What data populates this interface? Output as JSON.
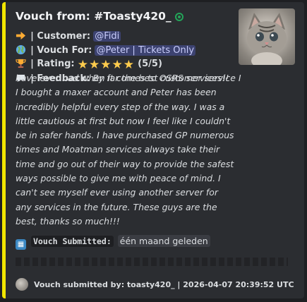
{
  "embed": {
    "accent_color": "#f1e500",
    "title": "Vouch from: #Toasty420_",
    "title_icon": "check-circle-icon",
    "customer_label": "| Customer:",
    "customer_mention": "@Fidi",
    "vouch_for_label": "| Vouch For:",
    "vouch_for_mention": "@Peter | Tickets Only",
    "rating_label": "| Rating:",
    "rating_stars": 5,
    "rating_text": "(5/5)",
    "feedback_label": "| Feedback:",
    "feedback_first": "By far the best customer service I",
    "feedback_rest": "have ever had when it comes to OSRS services!! I bought a maxer account and Peter has been incredibly helpful every step of the way. I was a little cautious at first but now I feel like I couldn't be in safer hands. I have purchased GP numerous times and Moatman services always take their time and go out of their way to provide the safest ways possible to give me with peace of mind. I can't see myself ever using another server for any services in the future. These guys are the best, thanks so much!!!",
    "submitted_label": "Vouch Submitted:",
    "submitted_time": "één maand geleden",
    "footer_text": "Vouch submitted by: toasty420_ | 2026-04-07 20:39:52 UTC",
    "icons": {
      "customer": "arrow-right-icon",
      "vouch_for": "globe-icon",
      "rating": "trophy-icon",
      "feedback": "speech-bubble-icon",
      "submitted": "calendar-icon"
    }
  }
}
